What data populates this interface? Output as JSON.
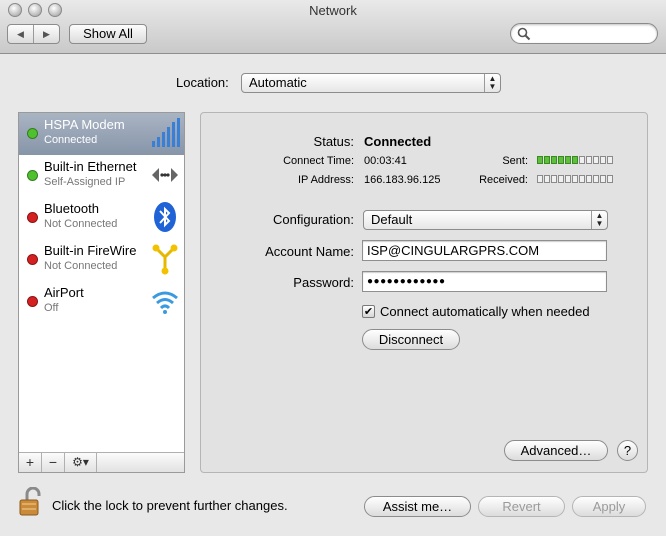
{
  "window": {
    "title": "Network"
  },
  "toolbar": {
    "back_glyph": "◀",
    "forward_glyph": "▶",
    "show_all_label": "Show All",
    "search_placeholder": ""
  },
  "location": {
    "label": "Location:",
    "value": "Automatic"
  },
  "services": [
    {
      "name": "HSPA Modem",
      "status": "Connected",
      "dot": "#4fc12f",
      "icon": "signal-bars-icon",
      "selected": true
    },
    {
      "name": "Built-in Ethernet",
      "status": "Self-Assigned IP",
      "dot": "#4fc12f",
      "icon": "ethernet-arrows-icon"
    },
    {
      "name": "Bluetooth",
      "status": "Not Connected",
      "dot": "#d42020",
      "icon": "bluetooth-icon"
    },
    {
      "name": "Built-in FireWire",
      "status": "Not Connected",
      "dot": "#d42020",
      "icon": "firewire-icon"
    },
    {
      "name": "AirPort",
      "status": "Off",
      "dot": "#d42020",
      "icon": "airport-wifi-icon"
    }
  ],
  "sidebar_tools": {
    "add": "+",
    "remove": "−",
    "gear": "⚙▾"
  },
  "detail": {
    "status_label": "Status:",
    "status_value": "Connected",
    "connect_time_label": "Connect Time:",
    "connect_time_value": "00:03:41",
    "ip_label": "IP Address:",
    "ip_value": "166.183.96.125",
    "sent_label": "Sent:",
    "sent_level_segments": 6,
    "received_label": "Received:",
    "received_level_segments": 0,
    "meter_total_segments": 11,
    "configuration_label": "Configuration:",
    "configuration_value": "Default",
    "account_label": "Account Name:",
    "account_value": "ISP@CINGULARGPRS.COM",
    "password_label": "Password:",
    "password_value": "●●●●●●●●●●●●",
    "auto_connect_checked": true,
    "auto_connect_label": "Connect automatically when needed",
    "disconnect_label": "Disconnect",
    "advanced_label": "Advanced…",
    "help_label": "?"
  },
  "footer": {
    "lock_text": "Click the lock to prevent further changes.",
    "assist_label": "Assist me…",
    "revert_label": "Revert",
    "apply_label": "Apply"
  },
  "colors": {
    "selection": "#8e9bb0",
    "meter_on": "#5fbf3c",
    "dot_green": "#4fc12f",
    "dot_red": "#d42020"
  }
}
